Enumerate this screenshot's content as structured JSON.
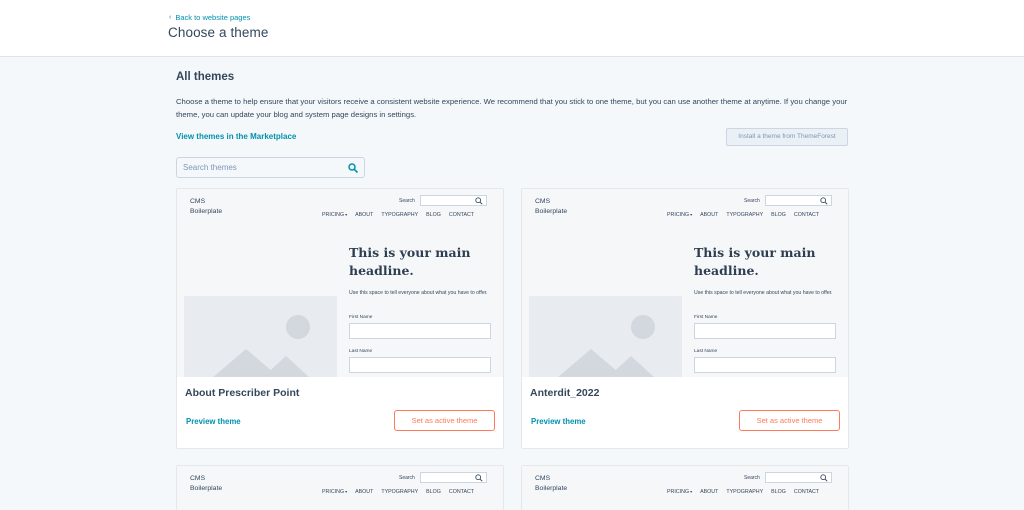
{
  "header": {
    "back_link": "Back to website pages",
    "title": "Choose a theme"
  },
  "section": {
    "title": "All themes",
    "description": "Choose a theme to help ensure that your visitors receive a consistent website experience. We recommend that you stick to one theme, but you can use another theme at anytime. If you change your theme, you can update your blog and system page designs in settings.",
    "marketplace_link": "View themes in the Marketplace",
    "install_button": "Install a theme from ThemeForest"
  },
  "search": {
    "placeholder": "Search themes"
  },
  "preview": {
    "brand_line1": "CMS",
    "brand_line2": "Boilerplate",
    "search_label": "Search",
    "nav": [
      "PRICING",
      "ABOUT",
      "TYPOGRAPHY",
      "BLOG",
      "CONTACT"
    ],
    "headline": "This is your main headline.",
    "subtext": "Use this space to tell everyone about what you have to offer.",
    "first_name": "First Name",
    "last_name": "Last Name"
  },
  "themes": [
    {
      "name": "About Prescriber Point",
      "preview_label": "Preview theme",
      "action_label": "Set as active theme"
    },
    {
      "name": "Anterdit_2022",
      "preview_label": "Preview theme",
      "action_label": "Set as active theme"
    }
  ],
  "colors": {
    "link": "#0091ae",
    "accent": "#ff7a59",
    "text": "#33475b",
    "background": "#f5f8fa"
  }
}
